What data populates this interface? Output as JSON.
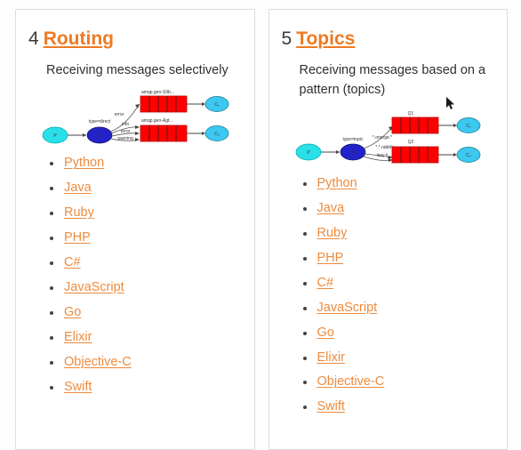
{
  "page": {
    "background": "#fdfdfd",
    "accent_orange": "#ee7a22",
    "link_orange": "#ee8b3d"
  },
  "cards": [
    {
      "number": "4",
      "title": "Routing",
      "description": "Receiving messages selectively",
      "diagram": {
        "producer": "P",
        "exchange": "X",
        "exchange_type": "type=direct",
        "queues": [
          {
            "label": "amqp.gen-S9b...",
            "consumer": "C",
            "consumer_sub": "1"
          },
          {
            "label": "amqp.gen-Agt...",
            "consumer": "C",
            "consumer_sub": "2"
          }
        ],
        "bindings_top": [
          "error"
        ],
        "bindings_bottom": [
          "info",
          "error",
          "warning"
        ],
        "colors": {
          "producer": "#29e0e8",
          "exchange": "#2222c8",
          "queue": "#ff0000",
          "consumer": "#3cc8f0"
        }
      },
      "languages": [
        "Python",
        "Java",
        "Ruby",
        "PHP",
        "C#",
        "JavaScript",
        "Go",
        "Elixir",
        "Objective-C",
        "Swift"
      ]
    },
    {
      "number": "5",
      "title": "Topics",
      "description": "Receiving messages based on a pattern (topics)",
      "diagram": {
        "producer": "P",
        "exchange": "X",
        "exchange_type": "type=topic",
        "queues": [
          {
            "label": "Q1",
            "consumer": "C",
            "consumer_sub": "1"
          },
          {
            "label": "Q2",
            "consumer": "C",
            "consumer_sub": "2"
          }
        ],
        "bindings_top": [
          "*.orange.*"
        ],
        "bindings_bottom": [
          "*.*.rabbit",
          "lazy.#"
        ],
        "colors": {
          "producer": "#29e0e8",
          "exchange": "#2222c8",
          "queue": "#ff0000",
          "consumer": "#3cc8f0"
        }
      },
      "languages": [
        "Python",
        "Java",
        "Ruby",
        "PHP",
        "C#",
        "JavaScript",
        "Go",
        "Elixir",
        "Objective-C",
        "Swift"
      ]
    }
  ],
  "cursor": {
    "name": "mouse-pointer",
    "visible": true
  }
}
